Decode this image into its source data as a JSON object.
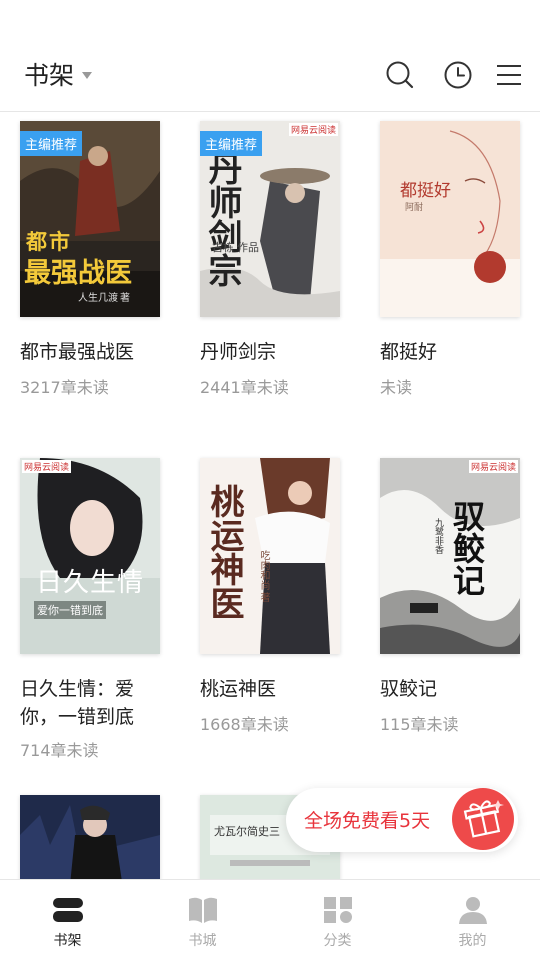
{
  "header": {
    "title": "书架",
    "icons": [
      "search-icon",
      "history-icon",
      "menu-icon"
    ]
  },
  "books": [
    {
      "title": "都市最强战医",
      "status": "3217章未读",
      "badge": "主编推荐",
      "cover_text": [
        "都市",
        "最强战医"
      ],
      "cover_author": "人生几渡",
      "cover_author_suffix": "著"
    },
    {
      "title": "丹师剑宗",
      "status": "2441章未读",
      "badge": "主编推荐",
      "cover_text": [
        "丹师",
        "剑宗"
      ],
      "cover_author": "古栋",
      "cover_author_suffix": "作品",
      "publisher": "网易云阅读"
    },
    {
      "title": "都挺好",
      "status": "未读",
      "cover_text": [
        "都挺好"
      ],
      "cover_author": "阿耐"
    },
    {
      "title": "日久生情：爱你，一错到底",
      "status": "714章未读",
      "cover_text": [
        "日久生情",
        "爱你一错到底"
      ],
      "publisher": "网易云阅读"
    },
    {
      "title": "桃运神医",
      "status": "1668章未读",
      "cover_text": [
        "桃运神医"
      ],
      "cover_author": "吃肉和尚",
      "cover_author_suffix": "著"
    },
    {
      "title": "驭鲛记",
      "status": "115章未读",
      "cover_text": [
        "驭鲛记"
      ],
      "cover_author": "九鹭非香",
      "publisher": "网易云阅读"
    },
    {
      "title": "",
      "status": ""
    },
    {
      "title": "",
      "status": "",
      "cover_text": [
        "尤瓦尔简史三"
      ]
    }
  ],
  "promo": {
    "text": "全场免费看5天"
  },
  "nav": [
    {
      "label": "书架",
      "icon": "bookshelf-icon",
      "active": true
    },
    {
      "label": "书城",
      "icon": "book-open-icon",
      "active": false
    },
    {
      "label": "分类",
      "icon": "category-grid-icon",
      "active": false
    },
    {
      "label": "我的",
      "icon": "profile-icon",
      "active": false
    }
  ],
  "colors": {
    "accent_red": "#e8343c",
    "badge_blue": "#3aa0f0",
    "text_primary": "#222222",
    "text_secondary": "#999999"
  }
}
